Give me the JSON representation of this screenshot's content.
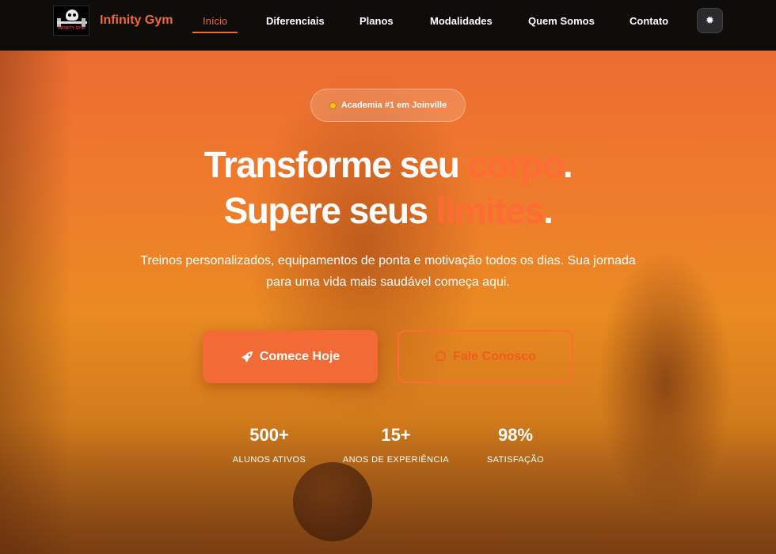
{
  "nav": {
    "logo_text": "INFINITY GYM",
    "brand": "Infinity Gym",
    "items": [
      {
        "label": "Início",
        "active": true
      },
      {
        "label": "Diferenciais"
      },
      {
        "label": "Planos"
      },
      {
        "label": "Modalidades"
      },
      {
        "label": "Quem Somos"
      },
      {
        "label": "Contato"
      }
    ],
    "theme_toggle_icon": "sun-icon"
  },
  "hero": {
    "badge": "Academia #1 em Joinville",
    "headline_line1": {
      "pre": "Transforme seu ",
      "highlight": "corpo",
      "post": "."
    },
    "headline_line2": {
      "pre": "Supere seus ",
      "highlight": "limites",
      "post": "."
    },
    "subtext": "Treinos personalizados, equipamentos de ponta e motivação todos os dias. Sua jornada para uma vida mais saudável começa aqui.",
    "cta_primary": {
      "label": "Comece Hoje",
      "icon": "rocket-icon"
    },
    "cta_secondary": {
      "label": "Fale Conosco",
      "icon": "whatsapp-icon"
    },
    "stats": [
      {
        "value": "500+",
        "label": "ALUNOS ATIVOS"
      },
      {
        "value": "15+",
        "label": "ANOS DE EXPERIÊNCIA"
      },
      {
        "value": "98%",
        "label": "SATISFAÇÃO"
      }
    ]
  },
  "colors": {
    "accent": "#ff6b35",
    "nav_bg": "#0f0d0c",
    "hero_overlay": "#ef7b2c"
  }
}
